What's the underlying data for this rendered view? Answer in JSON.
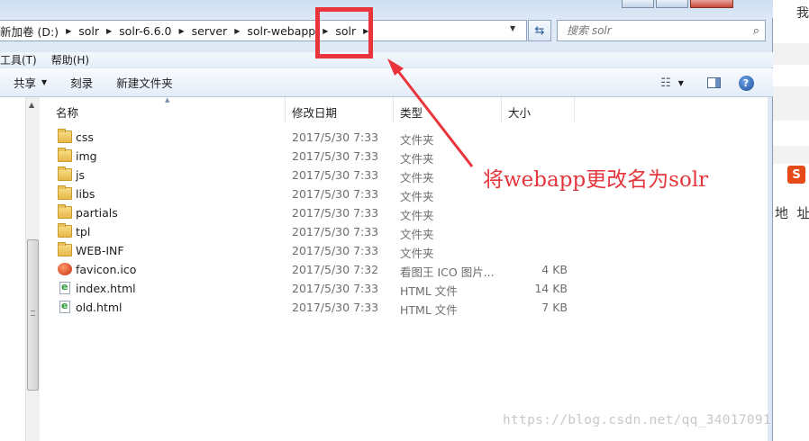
{
  "address_bar": {
    "breadcrumbs": [
      "新加卷 (D:)",
      "solr",
      "solr-6.6.0",
      "server",
      "solr-webapp",
      "solr"
    ]
  },
  "search": {
    "placeholder": "搜索 solr"
  },
  "menu": {
    "items": [
      "工具(T)",
      "帮助(H)"
    ]
  },
  "toolbar": {
    "share_label": "共享",
    "burn_label": "刻录",
    "new_folder_label": "新建文件夹"
  },
  "columns": {
    "name": "名称",
    "date": "修改日期",
    "type": "类型",
    "size": "大小"
  },
  "files": [
    {
      "name": "css",
      "date": "2017/5/30 7:33",
      "type": "文件夹",
      "size": "",
      "icon": "folder-icon"
    },
    {
      "name": "img",
      "date": "2017/5/30 7:33",
      "type": "文件夹",
      "size": "",
      "icon": "folder-icon"
    },
    {
      "name": "js",
      "date": "2017/5/30 7:33",
      "type": "文件夹",
      "size": "",
      "icon": "folder-icon"
    },
    {
      "name": "libs",
      "date": "2017/5/30 7:33",
      "type": "文件夹",
      "size": "",
      "icon": "folder-icon"
    },
    {
      "name": "partials",
      "date": "2017/5/30 7:33",
      "type": "文件夹",
      "size": "",
      "icon": "folder-icon"
    },
    {
      "name": "tpl",
      "date": "2017/5/30 7:33",
      "type": "文件夹",
      "size": "",
      "icon": "folder-icon"
    },
    {
      "name": "WEB-INF",
      "date": "2017/5/30 7:33",
      "type": "文件夹",
      "size": "",
      "icon": "folder-icon"
    },
    {
      "name": "favicon.ico",
      "date": "2017/5/30 7:32",
      "type": "看图王 ICO 图片...",
      "size": "4 KB",
      "icon": "ico-image-icon"
    },
    {
      "name": "index.html",
      "date": "2017/5/30 7:33",
      "type": "HTML 文件",
      "size": "14 KB",
      "icon": "html-file-icon"
    },
    {
      "name": "old.html",
      "date": "2017/5/30 7:33",
      "type": "HTML 文件",
      "size": "7 KB",
      "icon": "html-file-icon"
    }
  ],
  "annotation": {
    "text": "将webapp更改名为solr",
    "color": "#e5363c"
  },
  "right_fragments": {
    "top_char": "我",
    "mid_chars": "地  址",
    "sogou": "S"
  },
  "watermark": "https://blog.csdn.net/qq_34017091",
  "colors": {
    "highlight": "#e8343a",
    "window_bg": "#dfe9f5"
  }
}
